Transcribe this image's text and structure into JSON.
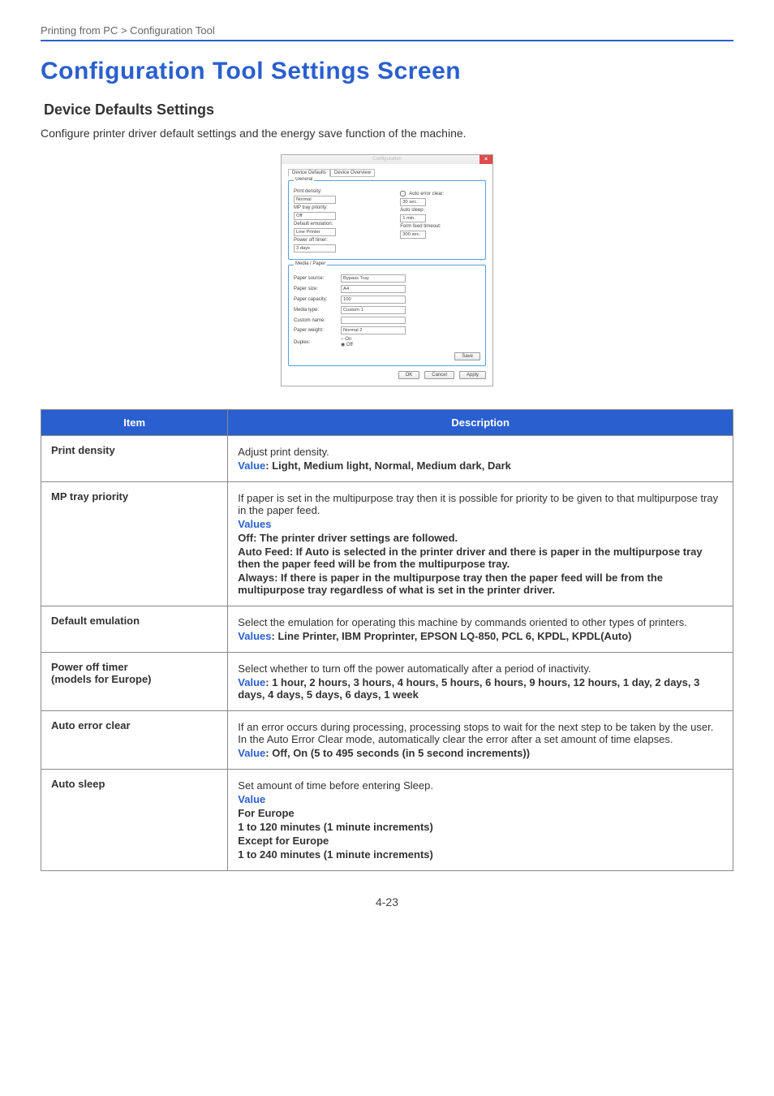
{
  "breadcrumb": "Printing from PC > Configuration Tool",
  "title": "Configuration Tool Settings Screen",
  "subsection": "Device Defaults Settings",
  "lead": "Configure printer driver default settings and the energy save function of the machine.",
  "page_number": "4-23",
  "dialog": {
    "window_title": "Configuration",
    "close_glyph": "×",
    "tabs": {
      "active": "Device Defaults",
      "other": "Device Overview"
    },
    "group_general": "General",
    "print_density_label": "Print density:",
    "print_density_value": "Normal",
    "mp_priority_label": "MP tray priority:",
    "mp_priority_value": "Off",
    "def_emu_label": "Default emulation:",
    "def_emu_value": "Line Printer",
    "power_off_label": "Power off timer:",
    "power_off_value": "3 days",
    "auto_err_label": "Auto error clear:",
    "auto_err_value": "30 sec.",
    "auto_sleep_label": "Auto sleep:",
    "auto_sleep_value": "1 min.",
    "form_feed_label": "Form feed timeout:",
    "form_feed_value": "300 sec.",
    "group_media": "Media / Paper",
    "paper_source_label": "Paper source:",
    "paper_source_value": "Bypass Tray",
    "paper_size_label": "Paper size:",
    "paper_size_value": "A4",
    "paper_capacity_label": "Paper capacity:",
    "paper_capacity_value": "100",
    "media_type_label": "Media type:",
    "media_type_value": "Custom 1",
    "custom_name_label": "Custom name:",
    "custom_name_value": "",
    "paper_weight_label": "Paper weight:",
    "paper_weight_value": "Normal 2",
    "duplex_label": "Duplex:",
    "duplex_on": "On",
    "duplex_off": "Off",
    "btn_save": "Save",
    "btn_ok": "OK",
    "btn_cancel": "Cancel",
    "btn_apply": "Apply"
  },
  "table": {
    "header_item": "Item",
    "header_desc": "Description",
    "rows": [
      {
        "item": "Print density",
        "desc_plain": "Adjust print density.",
        "value_kw": "Value",
        "value_text": ": Light, Medium light, Normal, Medium dark, Dark"
      },
      {
        "item": "MP tray priority",
        "desc_plain": "If paper is set in the multipurpose tray then it is possible for priority to be given to that multipurpose tray in the paper feed.",
        "values_kw": "Values",
        "line1": "Off: The printer driver settings are followed.",
        "line2": "Auto Feed: If Auto is selected in the printer driver and there is paper in the multipurpose tray then the paper feed will be from the multipurpose tray.",
        "line3": "Always: If there is paper in the multipurpose tray then the paper feed will be from the multipurpose tray regardless of what is set in the printer driver."
      },
      {
        "item": "Default emulation",
        "desc_plain": "Select the emulation for operating this machine by commands oriented to other types of printers.",
        "values_kw": "Values",
        "value_text": ": Line Printer, IBM Proprinter, EPSON LQ-850, PCL 6, KPDL, KPDL(Auto)"
      },
      {
        "item": "Power off timer\n(models for Europe)",
        "desc_plain": "Select whether to turn off the power automatically after a period of inactivity.",
        "value_kw": "Value",
        "value_text": ": 1 hour, 2 hours, 3 hours, 4 hours, 5 hours, 6 hours, 9 hours, 12 hours, 1 day, 2 days, 3 days, 4 days, 5 days, 6 days, 1 week"
      },
      {
        "item": "Auto error clear",
        "desc_plain": "If an error occurs during processing, processing stops to wait for the next step to be taken by the user. In the Auto Error Clear mode, automatically clear the error after a set amount of time elapses.",
        "value_kw": "Value",
        "value_text": ": Off, On (5 to 495 seconds (in 5 second increments))"
      },
      {
        "item": "Auto sleep",
        "desc_plain": "Set amount of time before entering Sleep.",
        "value_kw": "Value",
        "line1": "For Europe",
        "line2": "1 to 120 minutes (1 minute increments)",
        "line3": "Except for Europe",
        "line4": "1 to 240 minutes (1 minute increments)"
      }
    ]
  }
}
